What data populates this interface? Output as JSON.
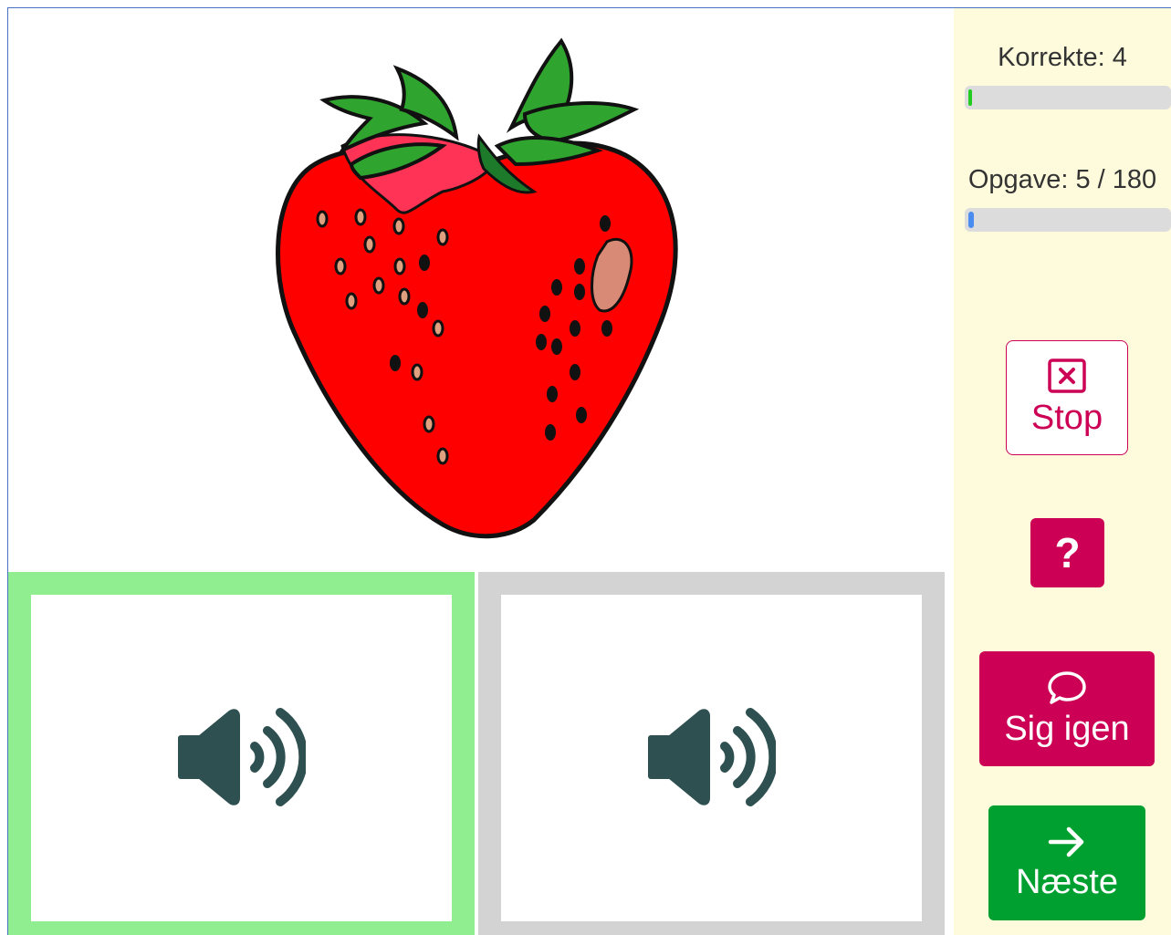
{
  "sidebar": {
    "correct_label": "Korrekte: 4",
    "correct_progress": 0.01,
    "task_label": "Opgave: 5 / 180",
    "task_progress": 0.028,
    "stop_label": "Stop",
    "help_label": "?",
    "say_again_label": "Sig igen",
    "next_label": "Næste"
  },
  "colors": {
    "correct_bar": "#22cc22",
    "task_bar": "#4a8cf0",
    "accent": "#cc0055",
    "next": "#00a030",
    "selected_choice": "#90ee90",
    "unselected_choice": "#d3d3d3",
    "sidebar_bg": "#fefbdc"
  },
  "picture": {
    "icon": "strawberry-image"
  },
  "choices": [
    {
      "icon": "speaker-icon",
      "state": "selected"
    },
    {
      "icon": "speaker-icon",
      "state": "unselected"
    }
  ]
}
